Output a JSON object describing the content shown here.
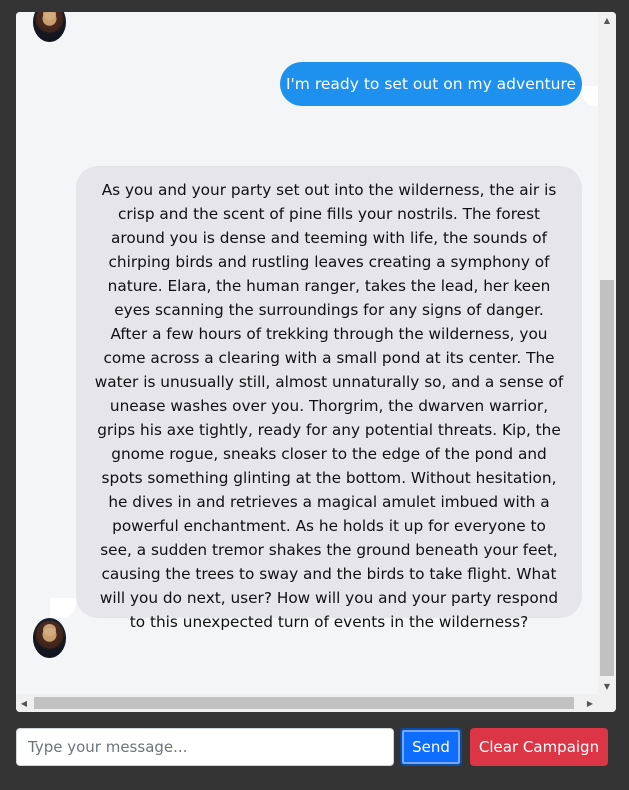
{
  "chat": {
    "messages": [
      {
        "sender": "user",
        "text": "I'm ready to set out on my adventure"
      },
      {
        "sender": "bot",
        "text": "As you and your party set out into the wilderness, the air is crisp and the scent of pine fills your nostrils. The forest around you is dense and teeming with life, the sounds of chirping birds and rustling leaves creating a symphony of nature. Elara, the human ranger, takes the lead, her keen eyes scanning the surroundings for any signs of danger. After a few hours of trekking through the wilderness, you come across a clearing with a small pond at its center. The water is unusually still, almost unnaturally so, and a sense of unease washes over you. Thorgrim, the dwarven warrior, grips his axe tightly, ready for any potential threats. Kip, the gnome rogue, sneaks closer to the edge of the pond and spots something glinting at the bottom. Without hesitation, he dives in and retrieves a magical amulet imbued with a powerful enchantment. As he holds it up for everyone to see, a sudden tremor shakes the ground beneath your feet, causing the trees to sway and the birds to take flight. What will you do next, user? How will you and your party respond to this unexpected turn of events in the wilderness?"
      }
    ]
  },
  "composer": {
    "placeholder": "Type your message...",
    "send_label": "Send",
    "clear_label": "Clear Campaign"
  },
  "icons": {
    "avatar": "character-avatar",
    "scroll_up": "scroll-up-arrow",
    "scroll_down": "scroll-down-arrow",
    "scroll_left": "scroll-left-arrow",
    "scroll_right": "scroll-right-arrow"
  },
  "colors": {
    "page_background": "#343434",
    "user_bubble": "#1e90ee",
    "bot_bubble": "#e5e5ea",
    "send_button": "#0d6efd",
    "clear_button": "#dc3545"
  }
}
